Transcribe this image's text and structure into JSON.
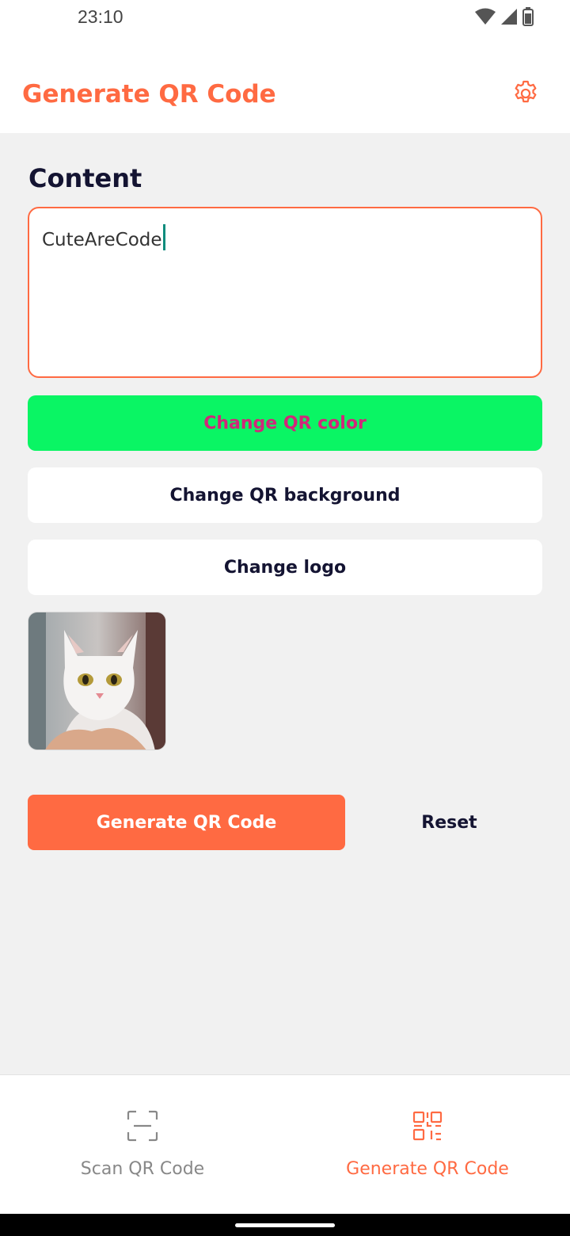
{
  "status_bar": {
    "time": "23:10",
    "icons": [
      "wifi-icon",
      "cell-signal-icon",
      "battery-icon"
    ]
  },
  "header": {
    "title": "Generate QR Code",
    "settings_icon": "gear-icon"
  },
  "content": {
    "label": "Content",
    "value": "CuteAreCode"
  },
  "buttons": {
    "change_color": "Change QR color",
    "change_background": "Change QR background",
    "change_logo": "Change logo",
    "generate": "Generate QR Code",
    "reset": "Reset"
  },
  "logo_preview": {
    "icon": "cat-photo"
  },
  "bottom_nav": {
    "items": [
      {
        "label": "Scan QR Code",
        "icon": "scan-icon",
        "active": false
      },
      {
        "label": "Generate QR Code",
        "icon": "qr-code-icon",
        "active": true
      }
    ]
  },
  "colors": {
    "accent": "#ff6a42",
    "color_button_bg": "#0af564",
    "color_button_text": "#d0287a",
    "dark_text": "#141432",
    "background": "#f1f1f1"
  }
}
